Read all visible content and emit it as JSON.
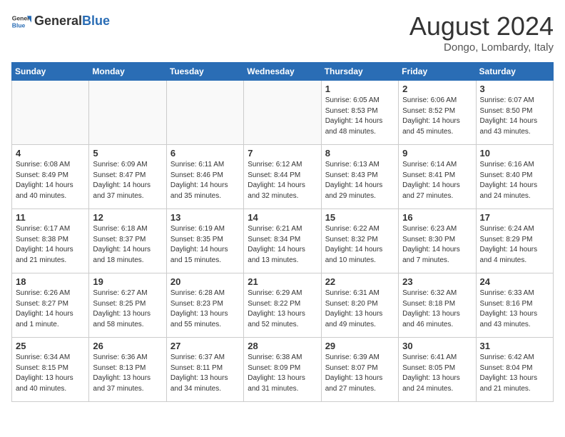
{
  "header": {
    "logo_general": "General",
    "logo_blue": "Blue",
    "month_year": "August 2024",
    "location": "Dongo, Lombardy, Italy"
  },
  "days_of_week": [
    "Sunday",
    "Monday",
    "Tuesday",
    "Wednesday",
    "Thursday",
    "Friday",
    "Saturday"
  ],
  "weeks": [
    [
      {
        "day": "",
        "info": ""
      },
      {
        "day": "",
        "info": ""
      },
      {
        "day": "",
        "info": ""
      },
      {
        "day": "",
        "info": ""
      },
      {
        "day": "1",
        "info": "Sunrise: 6:05 AM\nSunset: 8:53 PM\nDaylight: 14 hours\nand 48 minutes."
      },
      {
        "day": "2",
        "info": "Sunrise: 6:06 AM\nSunset: 8:52 PM\nDaylight: 14 hours\nand 45 minutes."
      },
      {
        "day": "3",
        "info": "Sunrise: 6:07 AM\nSunset: 8:50 PM\nDaylight: 14 hours\nand 43 minutes."
      }
    ],
    [
      {
        "day": "4",
        "info": "Sunrise: 6:08 AM\nSunset: 8:49 PM\nDaylight: 14 hours\nand 40 minutes."
      },
      {
        "day": "5",
        "info": "Sunrise: 6:09 AM\nSunset: 8:47 PM\nDaylight: 14 hours\nand 37 minutes."
      },
      {
        "day": "6",
        "info": "Sunrise: 6:11 AM\nSunset: 8:46 PM\nDaylight: 14 hours\nand 35 minutes."
      },
      {
        "day": "7",
        "info": "Sunrise: 6:12 AM\nSunset: 8:44 PM\nDaylight: 14 hours\nand 32 minutes."
      },
      {
        "day": "8",
        "info": "Sunrise: 6:13 AM\nSunset: 8:43 PM\nDaylight: 14 hours\nand 29 minutes."
      },
      {
        "day": "9",
        "info": "Sunrise: 6:14 AM\nSunset: 8:41 PM\nDaylight: 14 hours\nand 27 minutes."
      },
      {
        "day": "10",
        "info": "Sunrise: 6:16 AM\nSunset: 8:40 PM\nDaylight: 14 hours\nand 24 minutes."
      }
    ],
    [
      {
        "day": "11",
        "info": "Sunrise: 6:17 AM\nSunset: 8:38 PM\nDaylight: 14 hours\nand 21 minutes."
      },
      {
        "day": "12",
        "info": "Sunrise: 6:18 AM\nSunset: 8:37 PM\nDaylight: 14 hours\nand 18 minutes."
      },
      {
        "day": "13",
        "info": "Sunrise: 6:19 AM\nSunset: 8:35 PM\nDaylight: 14 hours\nand 15 minutes."
      },
      {
        "day": "14",
        "info": "Sunrise: 6:21 AM\nSunset: 8:34 PM\nDaylight: 14 hours\nand 13 minutes."
      },
      {
        "day": "15",
        "info": "Sunrise: 6:22 AM\nSunset: 8:32 PM\nDaylight: 14 hours\nand 10 minutes."
      },
      {
        "day": "16",
        "info": "Sunrise: 6:23 AM\nSunset: 8:30 PM\nDaylight: 14 hours\nand 7 minutes."
      },
      {
        "day": "17",
        "info": "Sunrise: 6:24 AM\nSunset: 8:29 PM\nDaylight: 14 hours\nand 4 minutes."
      }
    ],
    [
      {
        "day": "18",
        "info": "Sunrise: 6:26 AM\nSunset: 8:27 PM\nDaylight: 14 hours\nand 1 minute."
      },
      {
        "day": "19",
        "info": "Sunrise: 6:27 AM\nSunset: 8:25 PM\nDaylight: 13 hours\nand 58 minutes."
      },
      {
        "day": "20",
        "info": "Sunrise: 6:28 AM\nSunset: 8:23 PM\nDaylight: 13 hours\nand 55 minutes."
      },
      {
        "day": "21",
        "info": "Sunrise: 6:29 AM\nSunset: 8:22 PM\nDaylight: 13 hours\nand 52 minutes."
      },
      {
        "day": "22",
        "info": "Sunrise: 6:31 AM\nSunset: 8:20 PM\nDaylight: 13 hours\nand 49 minutes."
      },
      {
        "day": "23",
        "info": "Sunrise: 6:32 AM\nSunset: 8:18 PM\nDaylight: 13 hours\nand 46 minutes."
      },
      {
        "day": "24",
        "info": "Sunrise: 6:33 AM\nSunset: 8:16 PM\nDaylight: 13 hours\nand 43 minutes."
      }
    ],
    [
      {
        "day": "25",
        "info": "Sunrise: 6:34 AM\nSunset: 8:15 PM\nDaylight: 13 hours\nand 40 minutes."
      },
      {
        "day": "26",
        "info": "Sunrise: 6:36 AM\nSunset: 8:13 PM\nDaylight: 13 hours\nand 37 minutes."
      },
      {
        "day": "27",
        "info": "Sunrise: 6:37 AM\nSunset: 8:11 PM\nDaylight: 13 hours\nand 34 minutes."
      },
      {
        "day": "28",
        "info": "Sunrise: 6:38 AM\nSunset: 8:09 PM\nDaylight: 13 hours\nand 31 minutes."
      },
      {
        "day": "29",
        "info": "Sunrise: 6:39 AM\nSunset: 8:07 PM\nDaylight: 13 hours\nand 27 minutes."
      },
      {
        "day": "30",
        "info": "Sunrise: 6:41 AM\nSunset: 8:05 PM\nDaylight: 13 hours\nand 24 minutes."
      },
      {
        "day": "31",
        "info": "Sunrise: 6:42 AM\nSunset: 8:04 PM\nDaylight: 13 hours\nand 21 minutes."
      }
    ]
  ]
}
